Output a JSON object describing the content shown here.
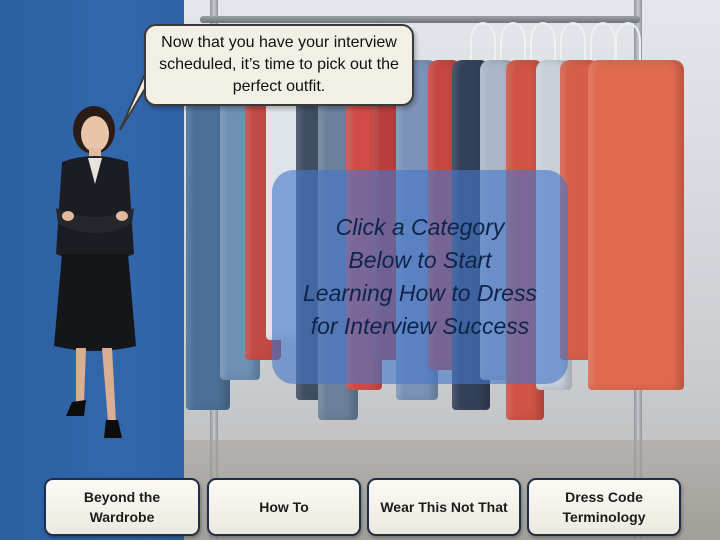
{
  "speech_bubble": {
    "text": "Now that you have your interview scheduled, it’s time to pick out the perfect outfit."
  },
  "instruction": {
    "text": "Click a Category\nBelow to Start\nLearning How to Dress\nfor Interview Success"
  },
  "categories": [
    {
      "label": "Beyond the\nWardrobe"
    },
    {
      "label": "How To"
    },
    {
      "label": "Wear This Not That"
    },
    {
      "label": "Dress Code\nTerminology"
    }
  ],
  "colors": {
    "panel_blue": "#2f62a6",
    "overlay_blue": "#4678c8",
    "button_fill": "#f7f5ee",
    "button_border": "#1d2e4a"
  }
}
